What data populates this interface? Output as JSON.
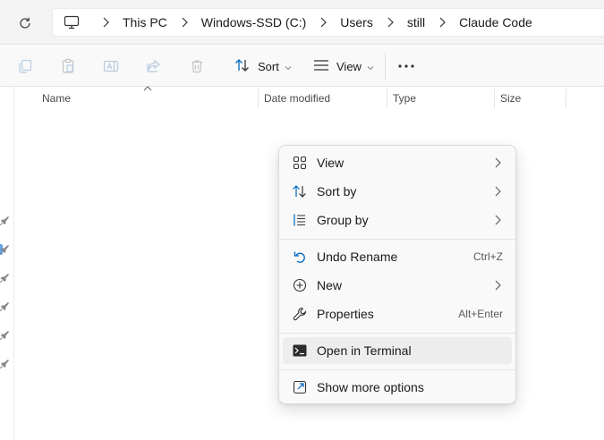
{
  "breadcrumb": {
    "items": [
      "This PC",
      "Windows-SSD (C:)",
      "Users",
      "still",
      "Claude Code"
    ]
  },
  "toolbar": {
    "sort_label": "Sort",
    "view_label": "View"
  },
  "columns": {
    "name": "Name",
    "date_modified": "Date modified",
    "type": "Type",
    "size": "Size"
  },
  "context_menu": {
    "view": "View",
    "sort_by": "Sort by",
    "group_by": "Group by",
    "undo_rename": "Undo Rename",
    "undo_rename_shortcut": "Ctrl+Z",
    "new": "New",
    "properties": "Properties",
    "properties_shortcut": "Alt+Enter",
    "open_in_terminal": "Open in Terminal",
    "show_more_options": "Show more options"
  },
  "colors": {
    "accent": "#0067c0",
    "menu_bg": "#f9f9f9",
    "highlight": "#ededed"
  }
}
